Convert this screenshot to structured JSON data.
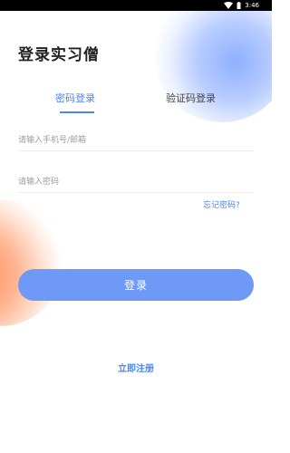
{
  "status_bar": {
    "time": "3:46",
    "wifi_icon": "wifi-icon",
    "battery_icon": "battery-icon"
  },
  "page": {
    "title": "登录实习僧"
  },
  "tabs": [
    {
      "label": "密码登录",
      "active": true
    },
    {
      "label": "验证码登录",
      "active": false
    }
  ],
  "form": {
    "account": {
      "placeholder": "请输入手机号/邮箱",
      "value": ""
    },
    "password": {
      "placeholder": "请输入密码",
      "value": ""
    },
    "forgot_label": "忘记密码?",
    "login_label": "登录"
  },
  "register_label": "立即注册",
  "colors": {
    "accent": "#4a86f5",
    "button": "#6f99f7",
    "blob_blue": "#8fb0ff",
    "blob_orange": "#ff8a5b"
  }
}
